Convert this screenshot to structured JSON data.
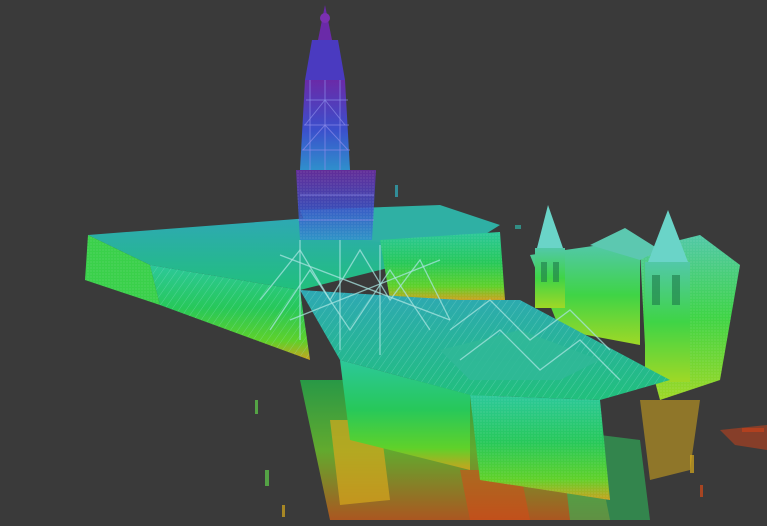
{
  "viewer": {
    "background_color": "#3a3a3a",
    "colormap": "elevation",
    "colormap_stops": [
      "#d2411a",
      "#e6a81a",
      "#3ad41e",
      "#1cc84a",
      "#22b6a0",
      "#3a8cd2",
      "#3f3fc8",
      "#6a2aa8"
    ],
    "subject": "point-cloud-church-building"
  }
}
